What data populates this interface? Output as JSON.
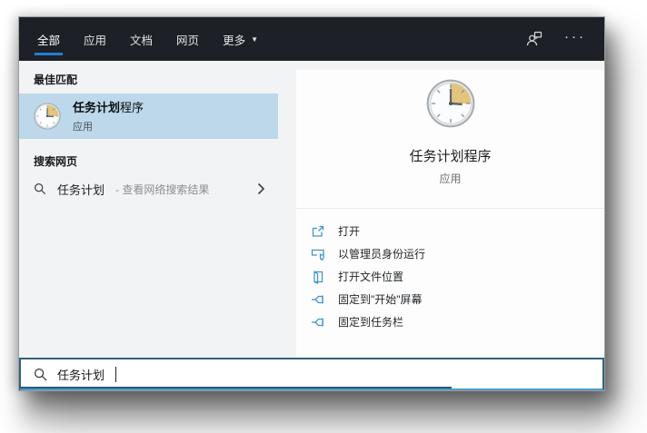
{
  "colors": {
    "topbar_bg": "#1d2127",
    "accent_blue": "#1f80d4",
    "panel_bg": "#f2f3f4",
    "highlight_bg": "#bcd8ea",
    "card_bg": "#fdfdfd",
    "icon_blue": "#4595cb",
    "input_border": "#33607b",
    "input_border_bottom": "#4a9bc9"
  },
  "tabs": [
    {
      "label": "全部",
      "active": true
    },
    {
      "label": "应用",
      "active": false
    },
    {
      "label": "文档",
      "active": false
    },
    {
      "label": "网页",
      "active": false
    },
    {
      "label": "更多",
      "active": false,
      "has_dropdown": true
    }
  ],
  "icons": {
    "dropdown_arrow": "▼",
    "ellipsis": "···"
  },
  "left_panel": {
    "best_match": {
      "header": "最佳匹配",
      "item": {
        "title_bold": "任务计划",
        "title_rest": "程序",
        "subtitle": "应用"
      }
    },
    "web_search": {
      "header": "搜索网页",
      "item": {
        "query": "任务计划",
        "suffix": " - 查看网络搜索结果"
      }
    }
  },
  "right_panel": {
    "app": {
      "title": "任务计划程序",
      "subtitle": "应用"
    },
    "actions": [
      {
        "icon": "open-icon",
        "label": "打开"
      },
      {
        "icon": "run-as-admin-icon",
        "label": "以管理员身份运行"
      },
      {
        "icon": "open-file-location-icon",
        "label": "打开文件位置"
      },
      {
        "icon": "pin-to-start-icon",
        "label": "固定到\"开始\"屏幕"
      },
      {
        "icon": "pin-to-taskbar-icon",
        "label": "固定到任务栏"
      }
    ]
  },
  "search_box": {
    "value": "任务计划"
  }
}
